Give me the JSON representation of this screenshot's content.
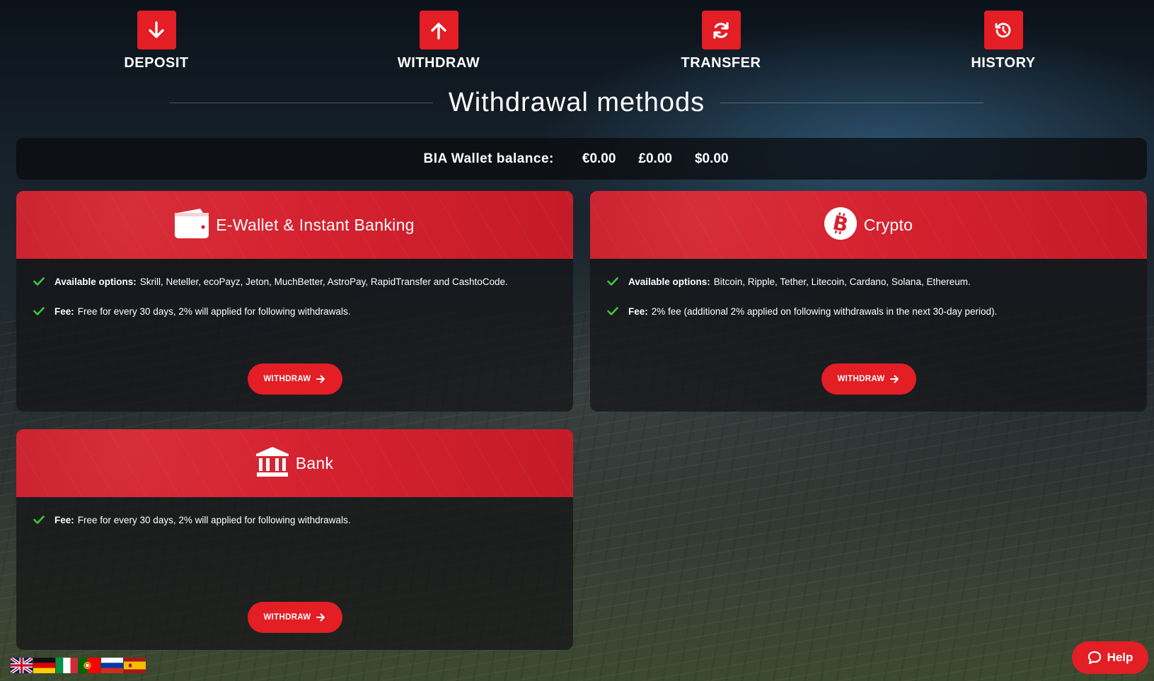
{
  "nav": {
    "items": [
      {
        "label": "DEPOSIT",
        "icon": "arrow-down-icon"
      },
      {
        "label": "WITHDRAW",
        "icon": "arrow-up-icon"
      },
      {
        "label": "TRANSFER",
        "icon": "refresh-icon"
      },
      {
        "label": "HISTORY",
        "icon": "history-icon"
      }
    ]
  },
  "page": {
    "title": "Withdrawal methods"
  },
  "balance": {
    "label": "BIA Wallet balance:",
    "eur": "€0.00",
    "gbp": "£0.00",
    "usd": "$0.00"
  },
  "methods": {
    "ewallet": {
      "title": "E-Wallet & Instant Banking",
      "icon": "wallet-icon",
      "options_label": "Available options:",
      "options_text": "Skrill, Neteller, ecoPayz, Jeton, MuchBetter, AstroPay, RapidTransfer and CashtoCode.",
      "fee_label": "Fee:",
      "fee_text": "Free for every 30 days, 2% will applied for following withdrawals.",
      "button": "WITHDRAW"
    },
    "crypto": {
      "title": "Crypto",
      "icon": "bitcoin-icon",
      "options_label": "Available options:",
      "options_text": "Bitcoin, Ripple, Tether, Litecoin, Cardano, Solana, Ethereum.",
      "fee_label": "Fee:",
      "fee_text": "2% fee (additional 2% applied on following withdrawals in the next 30-day period).",
      "button": "WITHDRAW"
    },
    "bank": {
      "title": "Bank",
      "icon": "bank-icon",
      "fee_label": "Fee:",
      "fee_text": "Free for every 30 days, 2% will applied for following withdrawals.",
      "button": "WITHDRAW"
    }
  },
  "languages": [
    "flag-uk-icon",
    "flag-germany-icon",
    "flag-italy-icon",
    "flag-portugal-icon",
    "flag-russia-icon",
    "flag-spain-icon"
  ],
  "help": {
    "label": "Help"
  },
  "colors": {
    "accent": "#e31e24",
    "card_header": "#d62230",
    "check": "#3ec93b"
  }
}
